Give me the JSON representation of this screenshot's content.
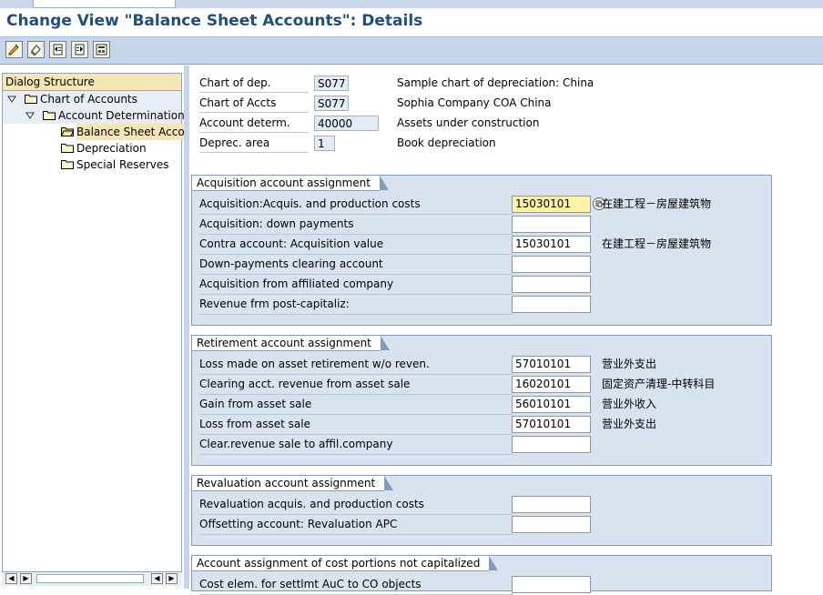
{
  "window": {
    "title": "Change View \"Balance Sheet Accounts\": Details"
  },
  "toolbar": {
    "icons": [
      "edit-icon",
      "undo-icon",
      "prev-entry-icon",
      "next-entry-icon",
      "variable-list-icon"
    ]
  },
  "dialog_structure": {
    "header": "Dialog Structure",
    "items": [
      {
        "label": "Chart of Accounts",
        "level": 1,
        "expanded": true
      },
      {
        "label": "Account Determination",
        "level": 2,
        "expanded": true
      },
      {
        "label": "Balance Sheet Accou",
        "level": 3,
        "selected": true
      },
      {
        "label": "Depreciation",
        "level": 3
      },
      {
        "label": "Special Reserves",
        "level": 3
      }
    ]
  },
  "header_fields": [
    {
      "label": "Chart of dep.",
      "value": "S077",
      "desc": "Sample chart of depreciation: China"
    },
    {
      "label": "Chart of Accts",
      "value": "S077",
      "desc": "Sophia Company COA China"
    },
    {
      "label": "Account determ.",
      "value": "40000",
      "desc": "Assets under construction"
    },
    {
      "label": "Deprec. area",
      "value": "1",
      "desc": "Book depreciation"
    }
  ],
  "groups": [
    {
      "title": "Acquisition account assignment",
      "rows": [
        {
          "label": "Acquisition:Acquis. and production costs",
          "value": "15030101",
          "desc": "在建工程－房屋建筑物",
          "focused": true
        },
        {
          "label": "Acquisition: down payments",
          "value": "",
          "desc": ""
        },
        {
          "label": "Contra account: Acquisition value",
          "value": "15030101",
          "desc": "在建工程－房屋建筑物"
        },
        {
          "label": "Down-payments clearing account",
          "value": "",
          "desc": ""
        },
        {
          "label": "Acquisition from affiliated company",
          "value": "",
          "desc": ""
        },
        {
          "label": "Revenue frm post-capitaliz:",
          "value": "",
          "desc": ""
        }
      ]
    },
    {
      "title": "Retirement account assignment",
      "rows": [
        {
          "label": "Loss made on asset retirement w/o reven.",
          "value": "57010101",
          "desc": "营业外支出"
        },
        {
          "label": "Clearing acct. revenue from asset sale",
          "value": "16020101",
          "desc": "固定资产清理-中转科目"
        },
        {
          "label": "Gain from asset sale",
          "value": "56010101",
          "desc": "营业外收入"
        },
        {
          "label": "Loss from asset sale",
          "value": "57010101",
          "desc": "营业外支出"
        },
        {
          "label": "Clear.revenue sale to affil.company",
          "value": "",
          "desc": ""
        }
      ]
    },
    {
      "title": "Revaluation account assignment",
      "rows": [
        {
          "label": "Revaluation acquis. and production costs",
          "value": "",
          "desc": ""
        },
        {
          "label": "Offsetting account: Revaluation APC",
          "value": "",
          "desc": ""
        }
      ]
    },
    {
      "title": "Account assignment of cost portions not capitalized",
      "rows": [
        {
          "label": "Cost elem. for settlmt AuC to CO objects",
          "value": "",
          "desc": ""
        }
      ]
    }
  ]
}
